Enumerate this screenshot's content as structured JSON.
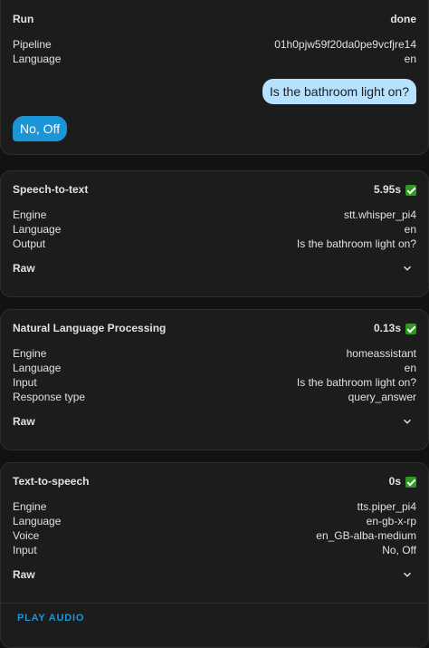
{
  "run": {
    "title": "Run",
    "status": "done",
    "pipeline_label": "Pipeline",
    "pipeline_value": "01h0pjw59f20da0pe9vcfjre14",
    "language_label": "Language",
    "language_value": "en",
    "user_message": "Is the bathroom light on?",
    "bot_message": "No, Off"
  },
  "stt": {
    "title": "Speech-to-text",
    "time": "5.95s",
    "rows": [
      {
        "label": "Engine",
        "value": "stt.whisper_pi4"
      },
      {
        "label": "Language",
        "value": "en"
      },
      {
        "label": "Output",
        "value": "Is the bathroom light on?"
      }
    ],
    "raw_label": "Raw"
  },
  "nlp": {
    "title": "Natural Language Processing",
    "time": "0.13s",
    "rows": [
      {
        "label": "Engine",
        "value": "homeassistant"
      },
      {
        "label": "Language",
        "value": "en"
      },
      {
        "label": "Input",
        "value": "Is the bathroom light on?"
      },
      {
        "label": "Response type",
        "value": "query_answer"
      }
    ],
    "raw_label": "Raw"
  },
  "tts": {
    "title": "Text-to-speech",
    "time": "0s",
    "rows": [
      {
        "label": "Engine",
        "value": "tts.piper_pi4"
      },
      {
        "label": "Language",
        "value": "en-gb-x-rp"
      },
      {
        "label": "Voice",
        "value": "en_GB-alba-medium"
      },
      {
        "label": "Input",
        "value": "No, Off"
      }
    ],
    "raw_label": "Raw",
    "play_label": "PLAY AUDIO"
  },
  "colors": {
    "accent": "#1b95d6",
    "user_bubble": "#b6e1ff",
    "check": "#2e9a1f"
  }
}
